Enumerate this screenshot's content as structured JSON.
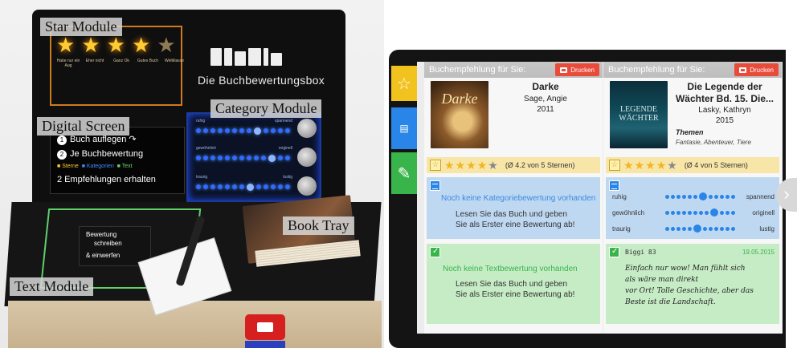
{
  "photo": {
    "labels": {
      "star_module": "Star Module",
      "digital_screen": "Digital Screen",
      "category_module": "Category Module",
      "book_tray": "Book Tray",
      "text_module": "Text Module"
    },
    "brand": "Die Buchbewertungsbox",
    "star_captions": [
      "Habe nur ein Aug",
      "Eher nicht",
      "Ganz Ok",
      "Gutes Buch",
      "Weltklasse"
    ],
    "screen": {
      "line1": "Buch auflegen",
      "line2": "Je Buchbewertung",
      "legend": [
        "Sterne",
        "Kategorien",
        "Text"
      ],
      "line4": "2 Empfehlungen erhalten"
    },
    "text_card": [
      "Bewertung",
      "schreiben",
      "& einwerfen"
    ],
    "category_words": [
      [
        "ruhig",
        "spannend"
      ],
      [
        "gewöhnlich",
        "originell"
      ],
      [
        "traurig",
        "lustig"
      ]
    ]
  },
  "app": {
    "tabs": [
      {
        "icon": "star-icon",
        "color": "#f2c21e"
      },
      {
        "icon": "list-icon",
        "color": "#2a85e8"
      },
      {
        "icon": "pen-icon",
        "color": "#39b44a"
      }
    ],
    "header_label": "Buchempfehlung für Sie:",
    "print_label": "Drucken",
    "left": {
      "title": "Darke",
      "author": "Sage, Angie",
      "year": "2011",
      "cover_text": "Darke",
      "stars_filled": 4,
      "stars_total": 5,
      "average": "(Ø 4.2 von 5 Sternen)",
      "category_msg": "Noch keine Kategoriebewertung vorhanden",
      "category_body": [
        "Lesen Sie das Buch und geben",
        "Sie als Erster eine Bewertung ab!"
      ],
      "text_msg": "Noch keine Textbewertung vorhanden",
      "text_body": [
        "Lesen Sie das Buch und geben",
        "Sie als Erster eine Bewertung ab!"
      ]
    },
    "right": {
      "title": "Die Legende der Wächter Bd. 15. Die...",
      "author": "Lasky, Kathryn",
      "year": "2015",
      "cover_text": "LEGENDE WÄCHTER",
      "themes_label": "Themen",
      "themes": "Fantasie, Abenteuer, Tiere",
      "stars_filled": 4,
      "stars_total": 5,
      "average": "(Ø 4 von 5 Sternen)",
      "categories": [
        {
          "left": "ruhig",
          "right": "spannend",
          "position": 7,
          "total": 12
        },
        {
          "left": "gewöhnlich",
          "right": "originell",
          "position": 9,
          "total": 12
        },
        {
          "left": "traurig",
          "right": "lustig",
          "position": 6,
          "total": 12
        }
      ],
      "review": {
        "user": "Biggi 83",
        "date": "19.05.2015",
        "text": [
          "Einfach nur wow! Man fühlt sich",
          "als wäre man direkt",
          "vor Ort! Tolle Geschichte, aber das",
          "Beste ist die Landschaft."
        ]
      }
    },
    "next_arrow": "›"
  },
  "colors": {
    "star": "#f2c21e",
    "category": "#2a85e8",
    "text": "#39b44a",
    "print": "#e84b3a"
  }
}
